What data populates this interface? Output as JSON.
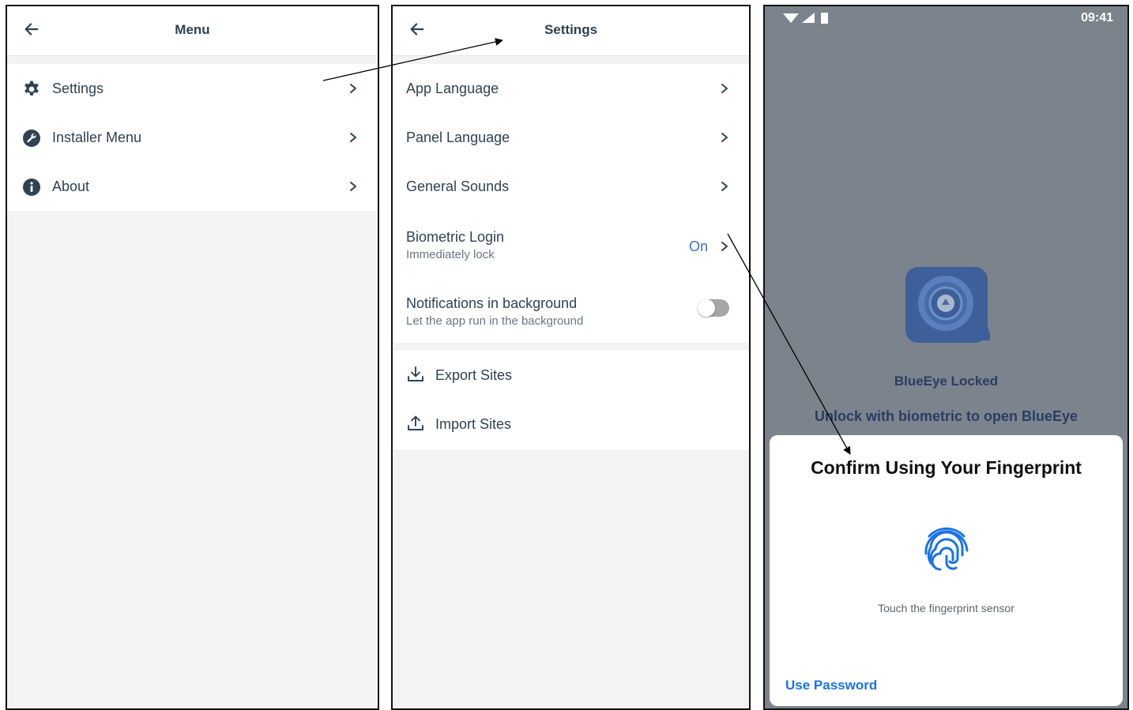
{
  "menu_screen": {
    "title": "Menu",
    "items": [
      {
        "label": "Settings",
        "icon": "gear-icon"
      },
      {
        "label": "Installer Menu",
        "icon": "wrench-icon"
      },
      {
        "label": "About",
        "icon": "info-icon"
      }
    ]
  },
  "settings_screen": {
    "title": "Settings",
    "items": [
      {
        "label": "App Language"
      },
      {
        "label": "Panel Language"
      },
      {
        "label": "General Sounds"
      },
      {
        "label": "Biometric Login",
        "sub": "Immediately lock",
        "value": "On"
      },
      {
        "label": "Notifications in background",
        "sub": "Let the app run in the background",
        "toggle_on": false
      }
    ],
    "actions": [
      {
        "label": "Export Sites",
        "icon": "download-icon"
      },
      {
        "label": "Import Sites",
        "icon": "upload-icon"
      }
    ]
  },
  "lock_screen": {
    "status_time": "09:41",
    "app_title": "BlueEye Locked",
    "app_subtitle": "Unlock with biometric to open BlueEye",
    "dialog": {
      "title": "Confirm Using Your Fingerprint",
      "hint": "Touch the fingerprint sensor",
      "use_password": "Use Password"
    }
  },
  "colors": {
    "accent_blue": "#1a73e8",
    "value_blue": "#3a74c4",
    "text_dark": "#2f4254",
    "lock_bg": "#7b838d"
  }
}
